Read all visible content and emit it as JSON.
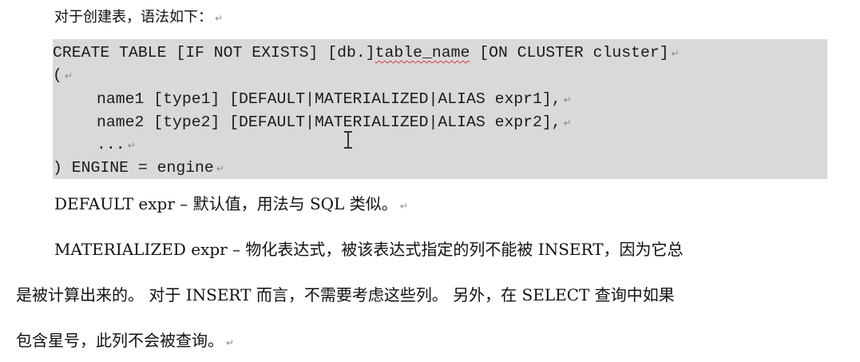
{
  "paragraph_mark": "↵",
  "intro": "对于创建表，语法如下：",
  "code": {
    "line1_a": "CREATE TABLE [IF NOT EXISTS] [db.]",
    "line1_b": "table_name",
    "line1_c": " [ON CLUSTER cluster]",
    "line2": "(",
    "line3": "name1 [type1] [DEFAULT|MATERIALIZED|ALIAS expr1],",
    "line4": "name2 [type2] [DEFAULT|MATERIALIZED|ALIAS expr2],",
    "line5": "...",
    "line6": ") ENGINE = engine"
  },
  "default_desc": "DEFAULT expr – 默认值，用法与 SQL 类似。",
  "materialized_desc": {
    "line1": "MATERIALIZED expr – 物化表达式，被该表达式指定的列不能被 INSERT，因为它总",
    "line2": "是被计算出来的。 对于 INSERT 而言，不需要考虑这些列。 另外，在 SELECT 查询中如果",
    "line3": "包含星号，此列不会被查询。"
  },
  "colors": {
    "code_background": "#d9d9d9",
    "spell_underline": "#d23a3a"
  },
  "icons": [
    "paragraph-mark-icon",
    "text-cursor-icon"
  ]
}
